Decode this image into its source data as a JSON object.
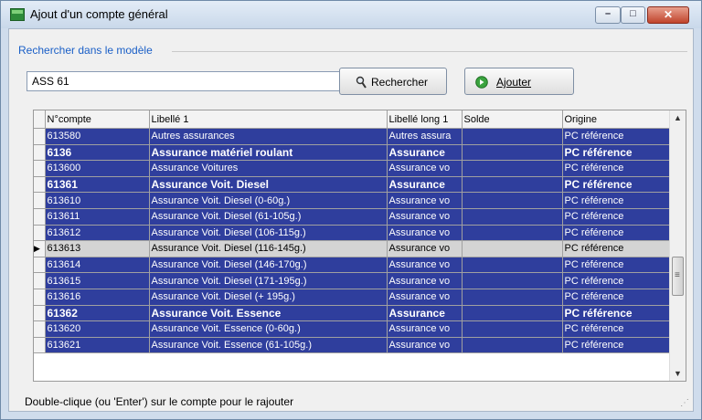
{
  "window": {
    "title": "Ajout d'un compte général",
    "controls": {
      "minimize": "–",
      "maximize": "□",
      "close": "✕"
    }
  },
  "groupbox": {
    "label": "Rechercher dans le modèle"
  },
  "search": {
    "value": "ASS 61"
  },
  "buttons": {
    "search_label": "Rechercher",
    "add_label": "Ajouter"
  },
  "table": {
    "columns": [
      "N°compte",
      "Libellé 1",
      "Libellé long 1",
      "Solde",
      "Origine"
    ],
    "rows": [
      {
        "num": "613580",
        "lib": "Autres assurances",
        "liblong": "Autres assura",
        "solde": "",
        "origine": "PC référence",
        "bold": false,
        "current": false
      },
      {
        "num": "6136",
        "lib": "Assurance matériel roulant",
        "liblong": "Assurance",
        "solde": "",
        "origine": "PC référence",
        "bold": true,
        "current": false
      },
      {
        "num": "613600",
        "lib": "Assurance Voitures",
        "liblong": "Assurance vo",
        "solde": "",
        "origine": "PC référence",
        "bold": false,
        "current": false
      },
      {
        "num": "61361",
        "lib": "Assurance Voit. Diesel",
        "liblong": "Assurance",
        "solde": "",
        "origine": "PC référence",
        "bold": true,
        "current": false
      },
      {
        "num": "613610",
        "lib": "Assurance Voit. Diesel (0-60g.)",
        "liblong": "Assurance vo",
        "solde": "",
        "origine": "PC référence",
        "bold": false,
        "current": false
      },
      {
        "num": "613611",
        "lib": "Assurance Voit. Diesel (61-105g.)",
        "liblong": "Assurance vo",
        "solde": "",
        "origine": "PC référence",
        "bold": false,
        "current": false
      },
      {
        "num": "613612",
        "lib": "Assurance Voit. Diesel (106-115g.)",
        "liblong": "Assurance vo",
        "solde": "",
        "origine": "PC référence",
        "bold": false,
        "current": false
      },
      {
        "num": "613613",
        "lib": "Assurance Voit. Diesel (116-145g.)",
        "liblong": "Assurance vo",
        "solde": "",
        "origine": "PC référence",
        "bold": false,
        "current": true
      },
      {
        "num": "613614",
        "lib": "Assurance Voit. Diesel (146-170g.)",
        "liblong": "Assurance vo",
        "solde": "",
        "origine": "PC référence",
        "bold": false,
        "current": false
      },
      {
        "num": "613615",
        "lib": "Assurance Voit. Diesel (171-195g.)",
        "liblong": "Assurance vo",
        "solde": "",
        "origine": "PC référence",
        "bold": false,
        "current": false
      },
      {
        "num": "613616",
        "lib": "Assurance Voit. Diesel (+ 195g.)",
        "liblong": "Assurance vo",
        "solde": "",
        "origine": "PC référence",
        "bold": false,
        "current": false
      },
      {
        "num": "61362",
        "lib": "Assurance Voit. Essence",
        "liblong": "Assurance",
        "solde": "",
        "origine": "PC référence",
        "bold": true,
        "current": false
      },
      {
        "num": "613620",
        "lib": "Assurance Voit. Essence (0-60g.)",
        "liblong": "Assurance vo",
        "solde": "",
        "origine": "PC référence",
        "bold": false,
        "current": false
      },
      {
        "num": "613621",
        "lib": "Assurance Voit. Essence (61-105g.)",
        "liblong": "Assurance vo",
        "solde": "",
        "origine": "PC référence",
        "bold": false,
        "current": false
      }
    ],
    "current_row_marker": "▶",
    "scroll": {
      "up": "▲",
      "down": "▼"
    }
  },
  "status": {
    "text": "Double-clique (ou 'Enter') sur le compte pour le rajouter"
  },
  "colors": {
    "selection": "#2f3e9d",
    "current_row": "#d4d4d4",
    "group_label": "#1a5fc7"
  },
  "icons": {
    "app": "app-icon",
    "search": "magnifier-icon",
    "add": "add-circle-icon"
  }
}
